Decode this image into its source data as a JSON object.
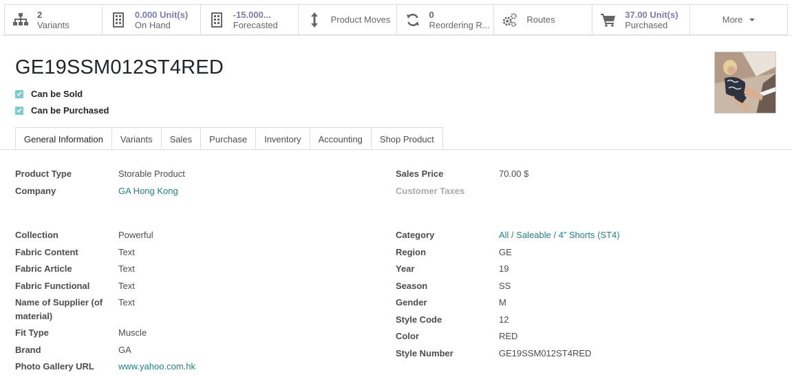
{
  "smart_buttons": {
    "variants": {
      "value": "2",
      "label": "Variants",
      "icon": "sitemap-icon"
    },
    "on_hand": {
      "value": "0.000 Unit(s)",
      "label": "On Hand",
      "icon": "building-icon"
    },
    "forecasted": {
      "value": "-15.000...",
      "label": "Forecasted",
      "icon": "building-icon"
    },
    "product_moves": {
      "label": "Product Moves",
      "icon": "arrows-vertical-icon"
    },
    "reordering": {
      "value": "0",
      "label": "Reordering R...",
      "icon": "refresh-icon"
    },
    "routes": {
      "label": "Routes",
      "icon": "cogs-icon"
    },
    "purchased": {
      "value": "37.00 Unit(s)",
      "label": "Purchased",
      "icon": "cart-icon"
    },
    "more": {
      "label": "More"
    }
  },
  "product": {
    "name": "GE19SSM012ST4RED",
    "can_be_sold": "Can be Sold",
    "can_be_purchased": "Can be Purchased"
  },
  "tabs": [
    "General Information",
    "Variants",
    "Sales",
    "Purchase",
    "Inventory",
    "Accounting",
    "Shop Product"
  ],
  "left_fields": {
    "product_type": {
      "label": "Product Type",
      "value": "Storable Product"
    },
    "company": {
      "label": "Company",
      "value": "GA Hong Kong"
    },
    "collection": {
      "label": "Collection",
      "value": "Powerful"
    },
    "fabric_content": {
      "label": "Fabric Content",
      "value": "Text"
    },
    "fabric_article": {
      "label": "Fabric Article",
      "value": "Text"
    },
    "fabric_functional": {
      "label": "Fabric Functional",
      "value": "Text"
    },
    "supplier_line1": {
      "label": "Name of Supplier (of",
      "value": "Text"
    },
    "supplier_line2": {
      "label": "material)"
    },
    "fit_type": {
      "label": "Fit Type",
      "value": "Muscle"
    },
    "brand": {
      "label": "Brand",
      "value": "GA"
    },
    "photo_gallery": {
      "label": "Photo Gallery URL",
      "value": "www.yahoo.com.hk"
    }
  },
  "right_fields": {
    "sales_price": {
      "label": "Sales Price",
      "value": "70.00 $"
    },
    "customer_taxes": {
      "label": "Customer Taxes",
      "value": ""
    },
    "category": {
      "label": "Category",
      "value": "All / Saleable / 4” Shorts (ST4)"
    },
    "region": {
      "label": "Region",
      "value": "GE"
    },
    "year": {
      "label": "Year",
      "value": "19"
    },
    "season": {
      "label": "Season",
      "value": "SS"
    },
    "gender": {
      "label": "Gender",
      "value": "M"
    },
    "style_code": {
      "label": "Style Code",
      "value": "12"
    },
    "color": {
      "label": "Color",
      "value": "RED"
    },
    "style_number": {
      "label": "Style Number",
      "value": "GE19SSM012ST4RED"
    }
  },
  "colors": {
    "accent": "#7c7bad",
    "link": "#21827f",
    "checkbox": "#7ecbcf"
  }
}
